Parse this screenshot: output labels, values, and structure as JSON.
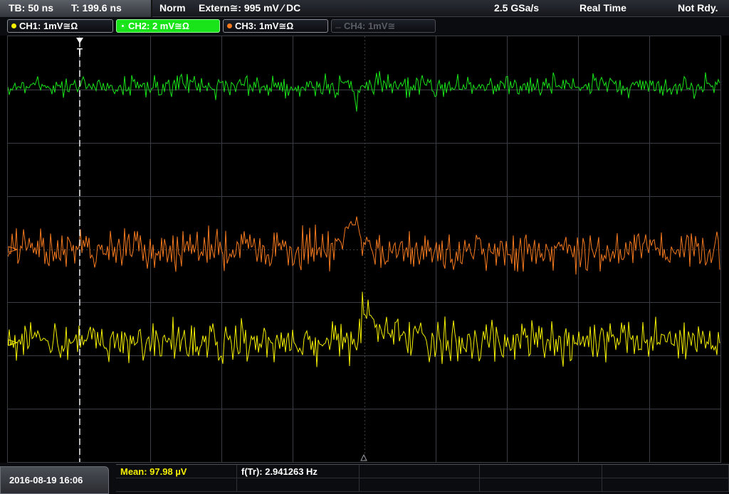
{
  "header": {
    "timebase": "TB: 50 ns",
    "trigger_time": "T: 199.6 ns",
    "acquire_mode": "Norm",
    "trigger_source": "Extern≅: 995 mV ∕ DC",
    "sample_rate": "2.5 GSa/s",
    "time_mode": "Real Time",
    "status": "Not Rdy."
  },
  "channels": [
    {
      "label": "CH1: 1mV≅Ω",
      "color": "#f5f000",
      "state": "on"
    },
    {
      "label": "CH2: 2 mV≅Ω",
      "color": "#19e319",
      "state": "selected"
    },
    {
      "label": "CH3: 1mV≅Ω",
      "color": "#f57a1f",
      "state": "on"
    },
    {
      "label": "CH4: 1mV≅",
      "color": "#5a5d63",
      "state": "off"
    }
  ],
  "footer": {
    "datetime": "2016-08-19 16:06",
    "measurements": [
      {
        "label": "Mean: 97.98 µV",
        "color": "#f5f000"
      },
      {
        "label": "f(Tr): 2.941263 Hz",
        "color": "#ffffff"
      }
    ]
  },
  "trigger_marker": "T",
  "colors": {
    "ch1": "#f5f000",
    "ch2": "#19e319",
    "ch3": "#f57a1f",
    "grid": "#3a3d44",
    "background": "#000000"
  }
}
